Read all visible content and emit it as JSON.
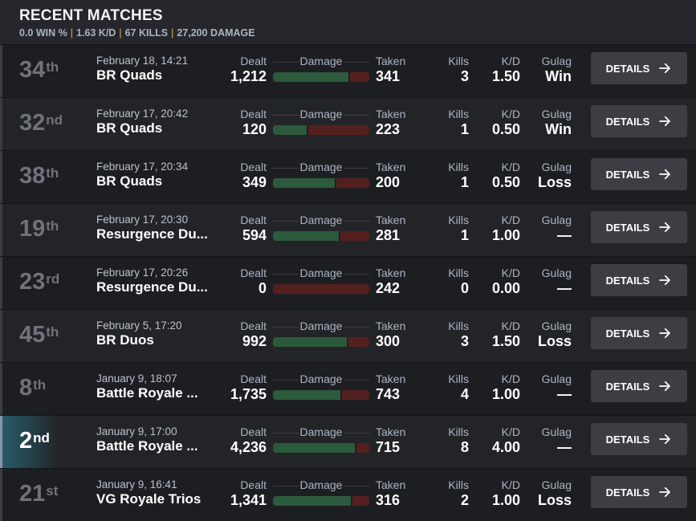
{
  "header": {
    "title": "RECENT MATCHES",
    "stats": [
      "0.0 WIN %",
      "1.63 K/D",
      "67 KILLS",
      "27,200 DAMAGE"
    ]
  },
  "labels": {
    "dealt": "Dealt",
    "damage": "Damage",
    "taken": "Taken",
    "kills": "Kills",
    "kd": "K/D",
    "gulag": "Gulag",
    "details": "DETAILS"
  },
  "colors": {
    "dealt_bar": "#2b5a3d",
    "taken_bar": "#54201f",
    "highlight": "#2a5a68"
  },
  "matches": [
    {
      "place": "34",
      "suffix": "th",
      "date": "February 18, 14:21",
      "mode": "BR Quads",
      "dealt": "1,212",
      "taken": "341",
      "kills": "3",
      "kd": "1.50",
      "gulag": "Win",
      "dealt_share": 0.78,
      "highlight": false
    },
    {
      "place": "32",
      "suffix": "nd",
      "date": "February 17, 20:42",
      "mode": "BR Quads",
      "dealt": "120",
      "taken": "223",
      "kills": "1",
      "kd": "0.50",
      "gulag": "Win",
      "dealt_share": 0.35,
      "highlight": false
    },
    {
      "place": "38",
      "suffix": "th",
      "date": "February 17, 20:34",
      "mode": "BR Quads",
      "dealt": "349",
      "taken": "200",
      "kills": "1",
      "kd": "0.50",
      "gulag": "Loss",
      "dealt_share": 0.64,
      "highlight": false
    },
    {
      "place": "19",
      "suffix": "th",
      "date": "February 17, 20:30",
      "mode": "Resurgence Du...",
      "dealt": "594",
      "taken": "281",
      "kills": "1",
      "kd": "1.00",
      "gulag": "—",
      "dealt_share": 0.68,
      "highlight": false
    },
    {
      "place": "23",
      "suffix": "rd",
      "date": "February 17, 20:26",
      "mode": "Resurgence Du...",
      "dealt": "0",
      "taken": "242",
      "kills": "0",
      "kd": "0.00",
      "gulag": "—",
      "dealt_share": 0.0,
      "highlight": false
    },
    {
      "place": "45",
      "suffix": "th",
      "date": "February 5, 17:20",
      "mode": "BR Duos",
      "dealt": "992",
      "taken": "300",
      "kills": "3",
      "kd": "1.50",
      "gulag": "Loss",
      "dealt_share": 0.77,
      "highlight": false
    },
    {
      "place": "8",
      "suffix": "th",
      "date": "January 9, 18:07",
      "mode": "Battle Royale ...",
      "dealt": "1,735",
      "taken": "743",
      "kills": "4",
      "kd": "1.00",
      "gulag": "—",
      "dealt_share": 0.7,
      "highlight": false
    },
    {
      "place": "2",
      "suffix": "nd",
      "date": "January 9, 17:00",
      "mode": "Battle Royale ...",
      "dealt": "4,236",
      "taken": "715",
      "kills": "8",
      "kd": "4.00",
      "gulag": "—",
      "dealt_share": 0.85,
      "highlight": true
    },
    {
      "place": "21",
      "suffix": "st",
      "date": "January 9, 16:41",
      "mode": "VG Royale Trios",
      "dealt": "1,341",
      "taken": "316",
      "kills": "2",
      "kd": "1.00",
      "gulag": "Loss",
      "dealt_share": 0.81,
      "highlight": false
    }
  ]
}
